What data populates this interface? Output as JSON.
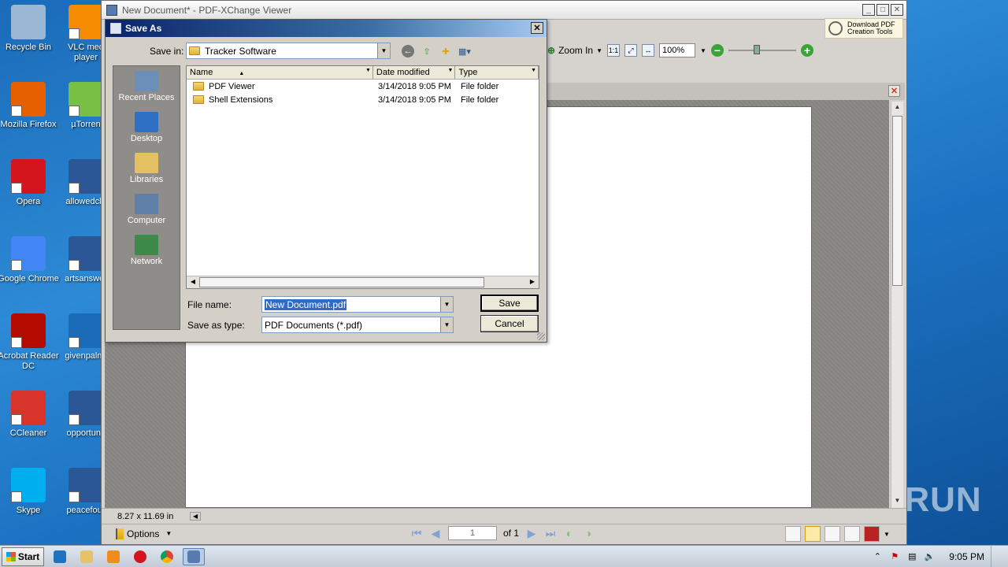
{
  "desktop": {
    "icons_left": [
      {
        "label": "Recycle Bin",
        "icon": "recycle-bin-icon",
        "color": "#9ab7d3"
      },
      {
        "label": "Mozilla Firefox",
        "icon": "firefox-icon",
        "color": "#e66000"
      },
      {
        "label": "Opera",
        "icon": "opera-icon",
        "color": "#d4151d"
      },
      {
        "label": "Google Chrome",
        "icon": "chrome-icon",
        "color": "#4285f4"
      },
      {
        "label": "Acrobat Reader DC",
        "icon": "acrobat-icon",
        "color": "#b30b00"
      },
      {
        "label": "CCleaner",
        "icon": "ccleaner-icon",
        "color": "#d9342b"
      },
      {
        "label": "Skype",
        "icon": "skype-icon",
        "color": "#00aff0"
      }
    ],
    "icons_right": [
      {
        "label": "VLC med player",
        "icon": "vlc-icon",
        "color": "#f48b00"
      },
      {
        "label": "µTorren",
        "icon": "utorrent-icon",
        "color": "#78c043"
      },
      {
        "label": "allowedcle",
        "icon": "word-doc-icon",
        "color": "#2b5797"
      },
      {
        "label": "artsanswer",
        "icon": "word-doc-icon",
        "color": "#2b5797"
      },
      {
        "label": "givenpalm.",
        "icon": "blank-doc-icon",
        "color": "#1a6bb8"
      },
      {
        "label": "opportunit",
        "icon": "word-doc-icon",
        "color": "#2b5797"
      },
      {
        "label": "peacefour",
        "icon": "word-doc-icon",
        "color": "#2b5797"
      }
    ],
    "watermark": "ANY RUN"
  },
  "app": {
    "title": "New Document* - PDF-XChange Viewer",
    "download_btn_line1": "Download PDF",
    "download_btn_line2": "Creation Tools",
    "zoom_in_label": "Zoom In",
    "zoom_value": "100%",
    "page_size": "8.27 x 11.69 in",
    "options_label": "Options",
    "current_page": "1",
    "page_of": "of 1"
  },
  "dialog": {
    "title": "Save As",
    "save_in_label": "Save in:",
    "save_in_value": "Tracker Software",
    "places": [
      {
        "label": "Recent Places",
        "icon": "recent-places-icon",
        "color": "#6b8fb8"
      },
      {
        "label": "Desktop",
        "icon": "desktop-icon",
        "color": "#2f6fc4"
      },
      {
        "label": "Libraries",
        "icon": "libraries-icon",
        "color": "#e3c062"
      },
      {
        "label": "Computer",
        "icon": "computer-icon",
        "color": "#5e7fa6"
      },
      {
        "label": "Network",
        "icon": "network-icon",
        "color": "#3d8a4a"
      }
    ],
    "columns": [
      "Name",
      "Date modified",
      "Type"
    ],
    "files": [
      {
        "name": "PDF Viewer",
        "date": "3/14/2018 9:05 PM",
        "type": "File folder"
      },
      {
        "name": "Shell Extensions",
        "date": "3/14/2018 9:05 PM",
        "type": "File folder"
      }
    ],
    "file_name_label": "File name:",
    "file_name_value": "New Document.pdf",
    "save_type_label": "Save as type:",
    "save_type_value": "PDF Documents (*.pdf)",
    "save_button": "Save",
    "cancel_button": "Cancel"
  },
  "taskbar": {
    "start_label": "Start",
    "clock": "9:05 PM"
  }
}
